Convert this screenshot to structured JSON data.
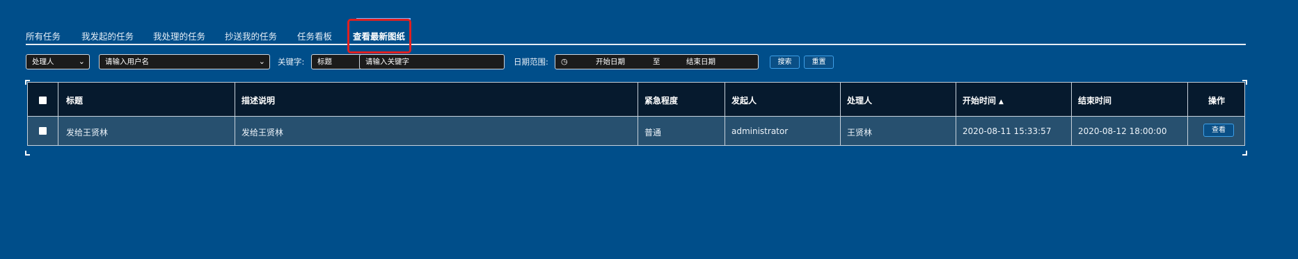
{
  "tabs": [
    {
      "label": "所有任务"
    },
    {
      "label": "我发起的任务"
    },
    {
      "label": "我处理的任务"
    },
    {
      "label": "抄送我的任务"
    },
    {
      "label": "任务看板"
    },
    {
      "label": "查看最新图纸",
      "active": true
    }
  ],
  "filters": {
    "role_select": "处理人",
    "user_select_placeholder": "请输入用户名",
    "keyword_label": "关键字:",
    "keyword_field_select": "标题",
    "keyword_placeholder": "请输入关键字",
    "date_label": "日期范围:",
    "date_start": "开始日期",
    "date_sep": "至",
    "date_end": "结束日期",
    "search_button": "搜索",
    "reset_button": "重置"
  },
  "table": {
    "headers": [
      "标题",
      "描述说明",
      "紧急程度",
      "发起人",
      "处理人",
      "开始时间",
      "结束时间",
      "操作"
    ],
    "sort_icon": "sort-icon",
    "rows": [
      {
        "title": "发给王贤林",
        "description": "发给王贤林",
        "urgency": "普通",
        "initiator": "administrator",
        "handler": "王贤林",
        "start": "2020-08-11 15:33:57",
        "end": "2020-08-12 18:00:00",
        "action": "查看"
      }
    ]
  },
  "colors": {
    "background": "#004e8a",
    "header_bg": "#061a2e",
    "row_bg": "#27506f",
    "button_border": "#3ea0e8",
    "highlight": "#e02020"
  }
}
